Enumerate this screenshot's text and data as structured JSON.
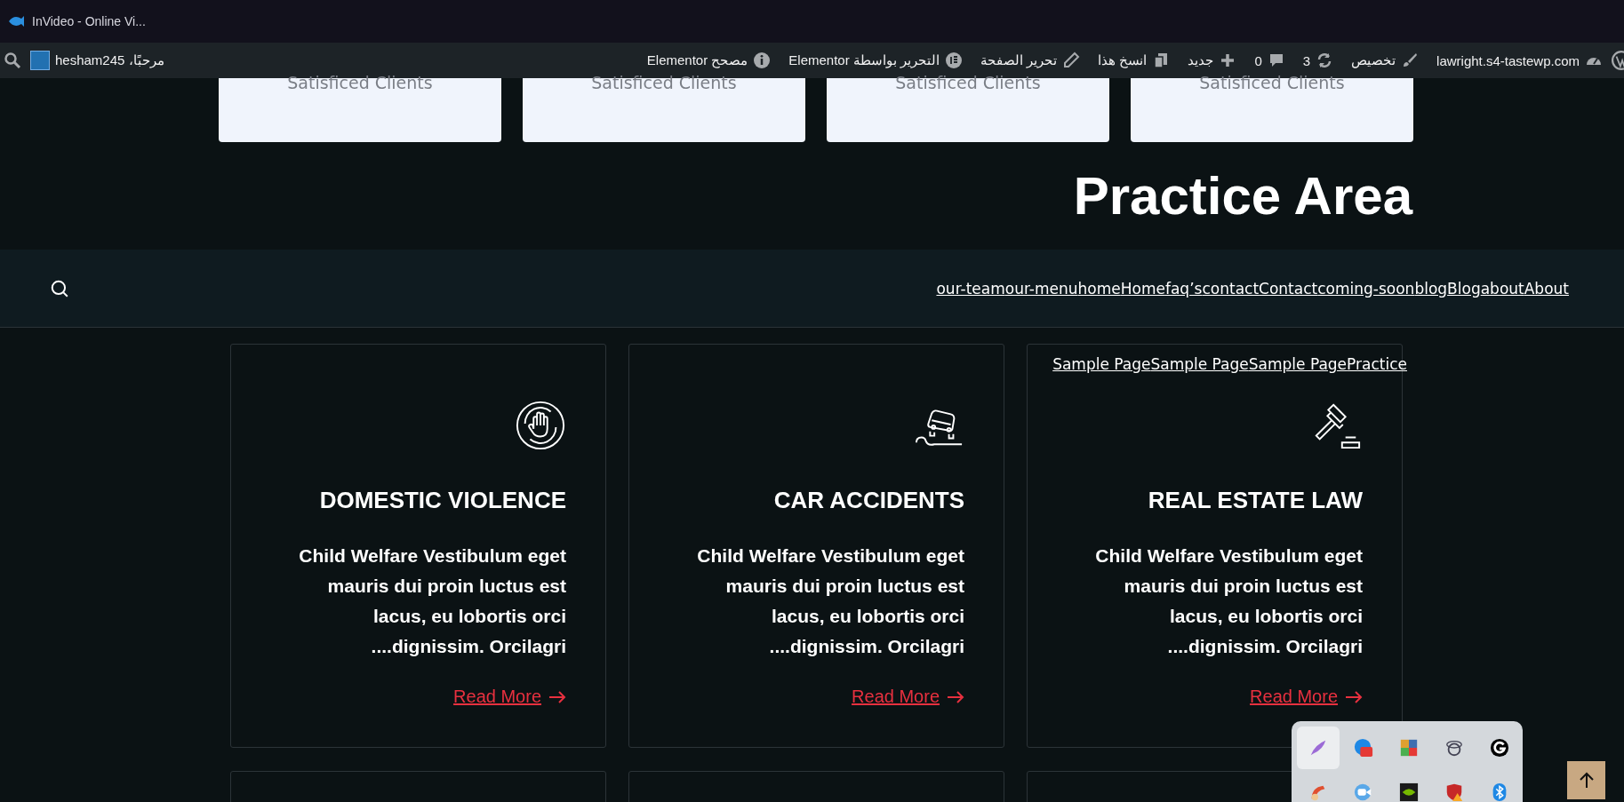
{
  "browser_tab": {
    "title": "InVideo - Online Vi..."
  },
  "admin_bar": {
    "items": [
      {
        "kind": "site",
        "label": "lawright.s4-tastewp.com"
      },
      {
        "kind": "customize",
        "label": "تخصيص"
      },
      {
        "kind": "updates",
        "label": "3"
      },
      {
        "kind": "comments",
        "label": "0"
      },
      {
        "kind": "new",
        "label": "جديد"
      },
      {
        "kind": "copy",
        "label": "انسخ هذا"
      },
      {
        "kind": "edit",
        "label": "تحرير الصفحة"
      },
      {
        "kind": "elementor",
        "label": "التحرير بواسطة Elementor"
      },
      {
        "kind": "debug",
        "label": "مصحح Elementor"
      }
    ],
    "greeting": "مرحبًا، hesham245"
  },
  "stat_cards": [
    {
      "label": "Satisficed Clients"
    },
    {
      "label": "Satisficed Clients"
    },
    {
      "label": "Satisficed Clients"
    },
    {
      "label": "Satisficed Clients"
    }
  ],
  "section_title": "Practice Area",
  "nav": {
    "links": [
      "our-team",
      "our-menu",
      "home",
      "Home",
      "faq’s",
      "contact",
      "Contact",
      "coming-soon",
      "blog",
      "Blog",
      "about",
      "About"
    ],
    "sub_links": [
      "Sample Page",
      "Sample Page",
      "Sample Page",
      "Practice"
    ]
  },
  "services": [
    {
      "kind": "hand",
      "title": "DOMESTIC VIOLENCE",
      "text": "Child Welfare Vestibulum eget mauris dui proin luctus est lacus, eu lobortis orci ....dignissim. Orcilagri",
      "link": "Read More"
    },
    {
      "kind": "car",
      "title": "CAR ACCIDENTS",
      "text": "Child Welfare Vestibulum eget mauris dui proin luctus est lacus, eu lobortis orci ....dignissim. Orcilagri",
      "link": "Read More"
    },
    {
      "kind": "gavel",
      "title": "REAL ESTATE LAW",
      "text": "Child Welfare Vestibulum eget mauris dui proin luctus est lacus, eu lobortis orci ....dignissim. Orcilagri",
      "link": "Read More"
    }
  ],
  "services_next_row": [
    {
      "kind": "card"
    },
    {
      "kind": "card"
    },
    {
      "kind": "card"
    }
  ],
  "tray": {
    "icons": [
      {
        "kind": "quill",
        "selected": true
      },
      {
        "kind": "badge",
        "selected": false
      },
      {
        "kind": "tiles",
        "selected": false
      },
      {
        "kind": "rings",
        "selected": false
      },
      {
        "kind": "letter",
        "selected": false
      },
      {
        "kind": "brush",
        "selected": false
      },
      {
        "kind": "camera",
        "selected": false
      },
      {
        "kind": "eye",
        "selected": false
      },
      {
        "kind": "shield",
        "selected": false
      },
      {
        "kind": "bluetooth",
        "selected": false
      }
    ]
  }
}
